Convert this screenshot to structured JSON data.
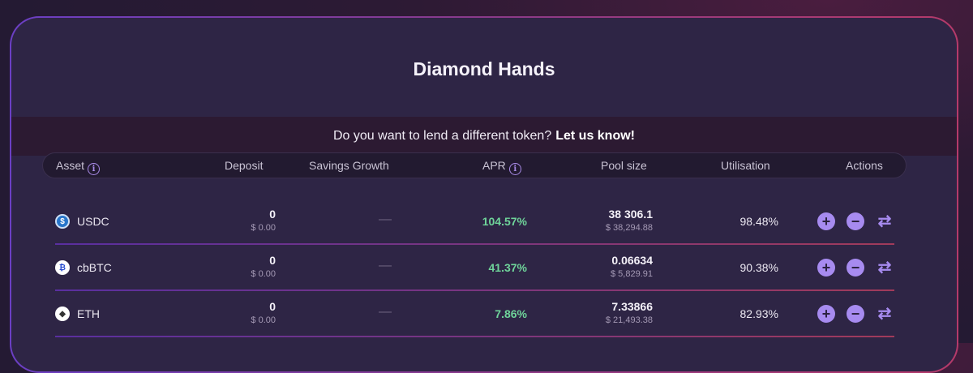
{
  "title": "Diamond Hands",
  "banner": {
    "text": "Do you want to lend a different token?",
    "link": "Let us know!"
  },
  "headers": {
    "asset": "Asset",
    "deposit": "Deposit",
    "savings_growth": "Savings Growth",
    "apr": "APR",
    "pool_size": "Pool size",
    "utilisation": "Utilisation",
    "actions": "Actions"
  },
  "rows": [
    {
      "asset": "USDC",
      "icon": "usdc-icon",
      "deposit": "0",
      "deposit_usd": "$ 0.00",
      "growth": "—",
      "apr": "104.57%",
      "pool": "38 306.1",
      "pool_usd": "$ 38,294.88",
      "util": "98.48%"
    },
    {
      "asset": "cbBTC",
      "icon": "cbbtc-icon",
      "deposit": "0",
      "deposit_usd": "$ 0.00",
      "growth": "—",
      "apr": "41.37%",
      "pool": "0.06634",
      "pool_usd": "$ 5,829.91",
      "util": "90.38%"
    },
    {
      "asset": "ETH",
      "icon": "eth-icon",
      "deposit": "0",
      "deposit_usd": "$ 0.00",
      "growth": "—",
      "apr": "7.86%",
      "pool": "7.33866",
      "pool_usd": "$ 21,493.38",
      "util": "82.93%"
    }
  ],
  "colors": {
    "accent": "#a78bf0",
    "apr_green": "#6fd49a",
    "card_bg": "#2e2545"
  }
}
